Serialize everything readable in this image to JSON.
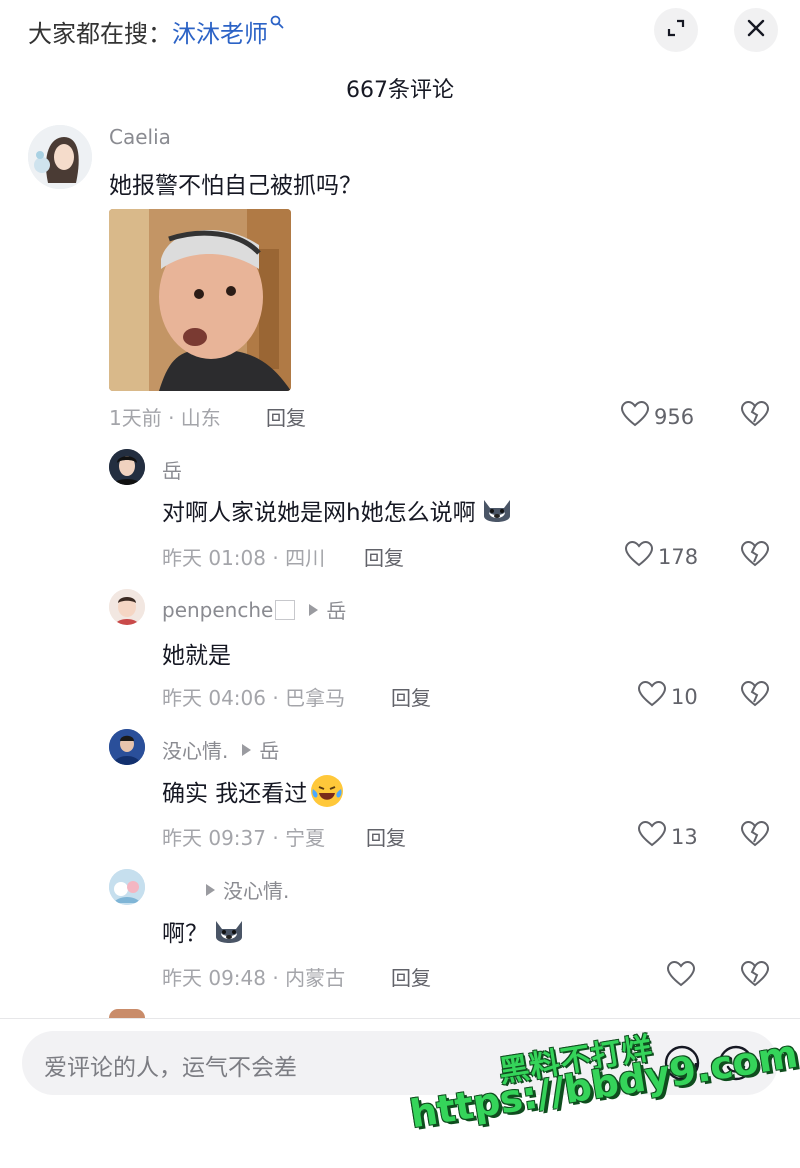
{
  "header": {
    "search_prefix": "大家都在搜：",
    "search_term": "沐沐老师",
    "search_icon": "magnifier-icon",
    "expand_icon": "expand-icon",
    "close_icon": "close-icon",
    "comment_count_title": "667条评论"
  },
  "comments": [
    {
      "username": "Caelia",
      "text": "她报警不怕自己被抓吗？",
      "has_sticker": true,
      "time_location": "1天前 · 山东",
      "reply_label": "回复",
      "likes": "956"
    }
  ],
  "replies": [
    {
      "username": "岳",
      "text": "对啊人家说她是网h她怎么说啊",
      "emoji": "husky-emoji",
      "time_location": "昨天 01:08 · 四川",
      "reply_label": "回复",
      "likes": "178"
    },
    {
      "username": "penpenche",
      "reply_to": "岳",
      "text": "她就是",
      "time_location": "昨天 04:06 · 巴拿马",
      "reply_label": "回复",
      "likes": "10"
    },
    {
      "username": "没心情.",
      "reply_to": "岳",
      "text": "确实 我还看过",
      "emoji": "laugh-cry-emoji",
      "time_location": "昨天 09:37 · 宁夏",
      "reply_label": "回复",
      "likes": "13"
    },
    {
      "username": "",
      "reply_to": "没心情.",
      "text": "啊？",
      "emoji": "husky-emoji",
      "time_location": "昨天 09:48 · 内蒙古",
      "reply_label": "回复",
      "likes": ""
    }
  ],
  "input": {
    "placeholder": "爱评论的人，运气不会差",
    "at_icon": "at-icon",
    "emoji_icon": "emoji-icon"
  },
  "watermark": {
    "line1": "黑料不打烊",
    "line2": "https://bbdy9.com"
  },
  "colors": {
    "search_term": "#2c63c6",
    "text_primary": "#161823",
    "text_secondary": "#a4a5aa",
    "watermark": "#35d45a"
  }
}
